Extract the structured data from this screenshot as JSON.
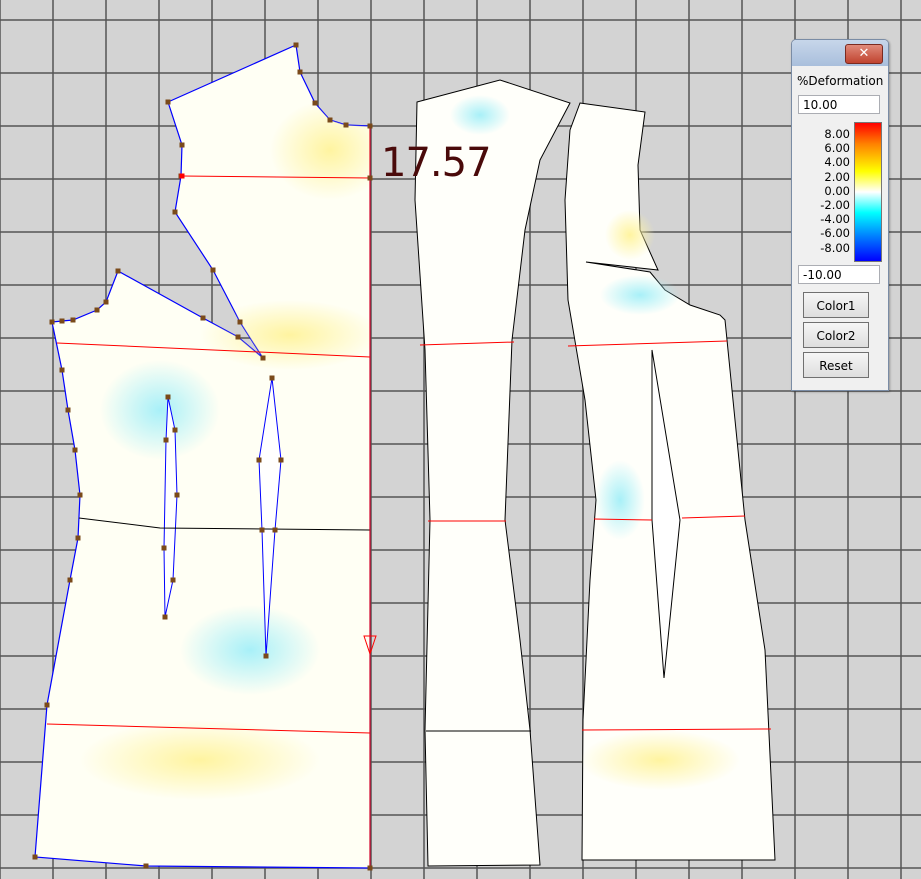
{
  "measurement": "17.57",
  "panel": {
    "title": "%Deformation",
    "close_icon": "close-icon",
    "max_value": "10.00",
    "min_value": "-10.00",
    "scale_labels": [
      "8.00",
      "6.00",
      "4.00",
      "2.00",
      "0.00",
      "-2.00",
      "-4.00",
      "-6.00",
      "-8.00"
    ],
    "buttons": {
      "color1": "Color1",
      "color2": "Color2",
      "reset": "Reset"
    }
  },
  "colors": {
    "background": "#d3d3d3",
    "grid": "#555555",
    "outline": "#0000ff",
    "guide": "#ff0000",
    "handle": "#7a4a1a",
    "measurement": "#4a0a0a"
  }
}
